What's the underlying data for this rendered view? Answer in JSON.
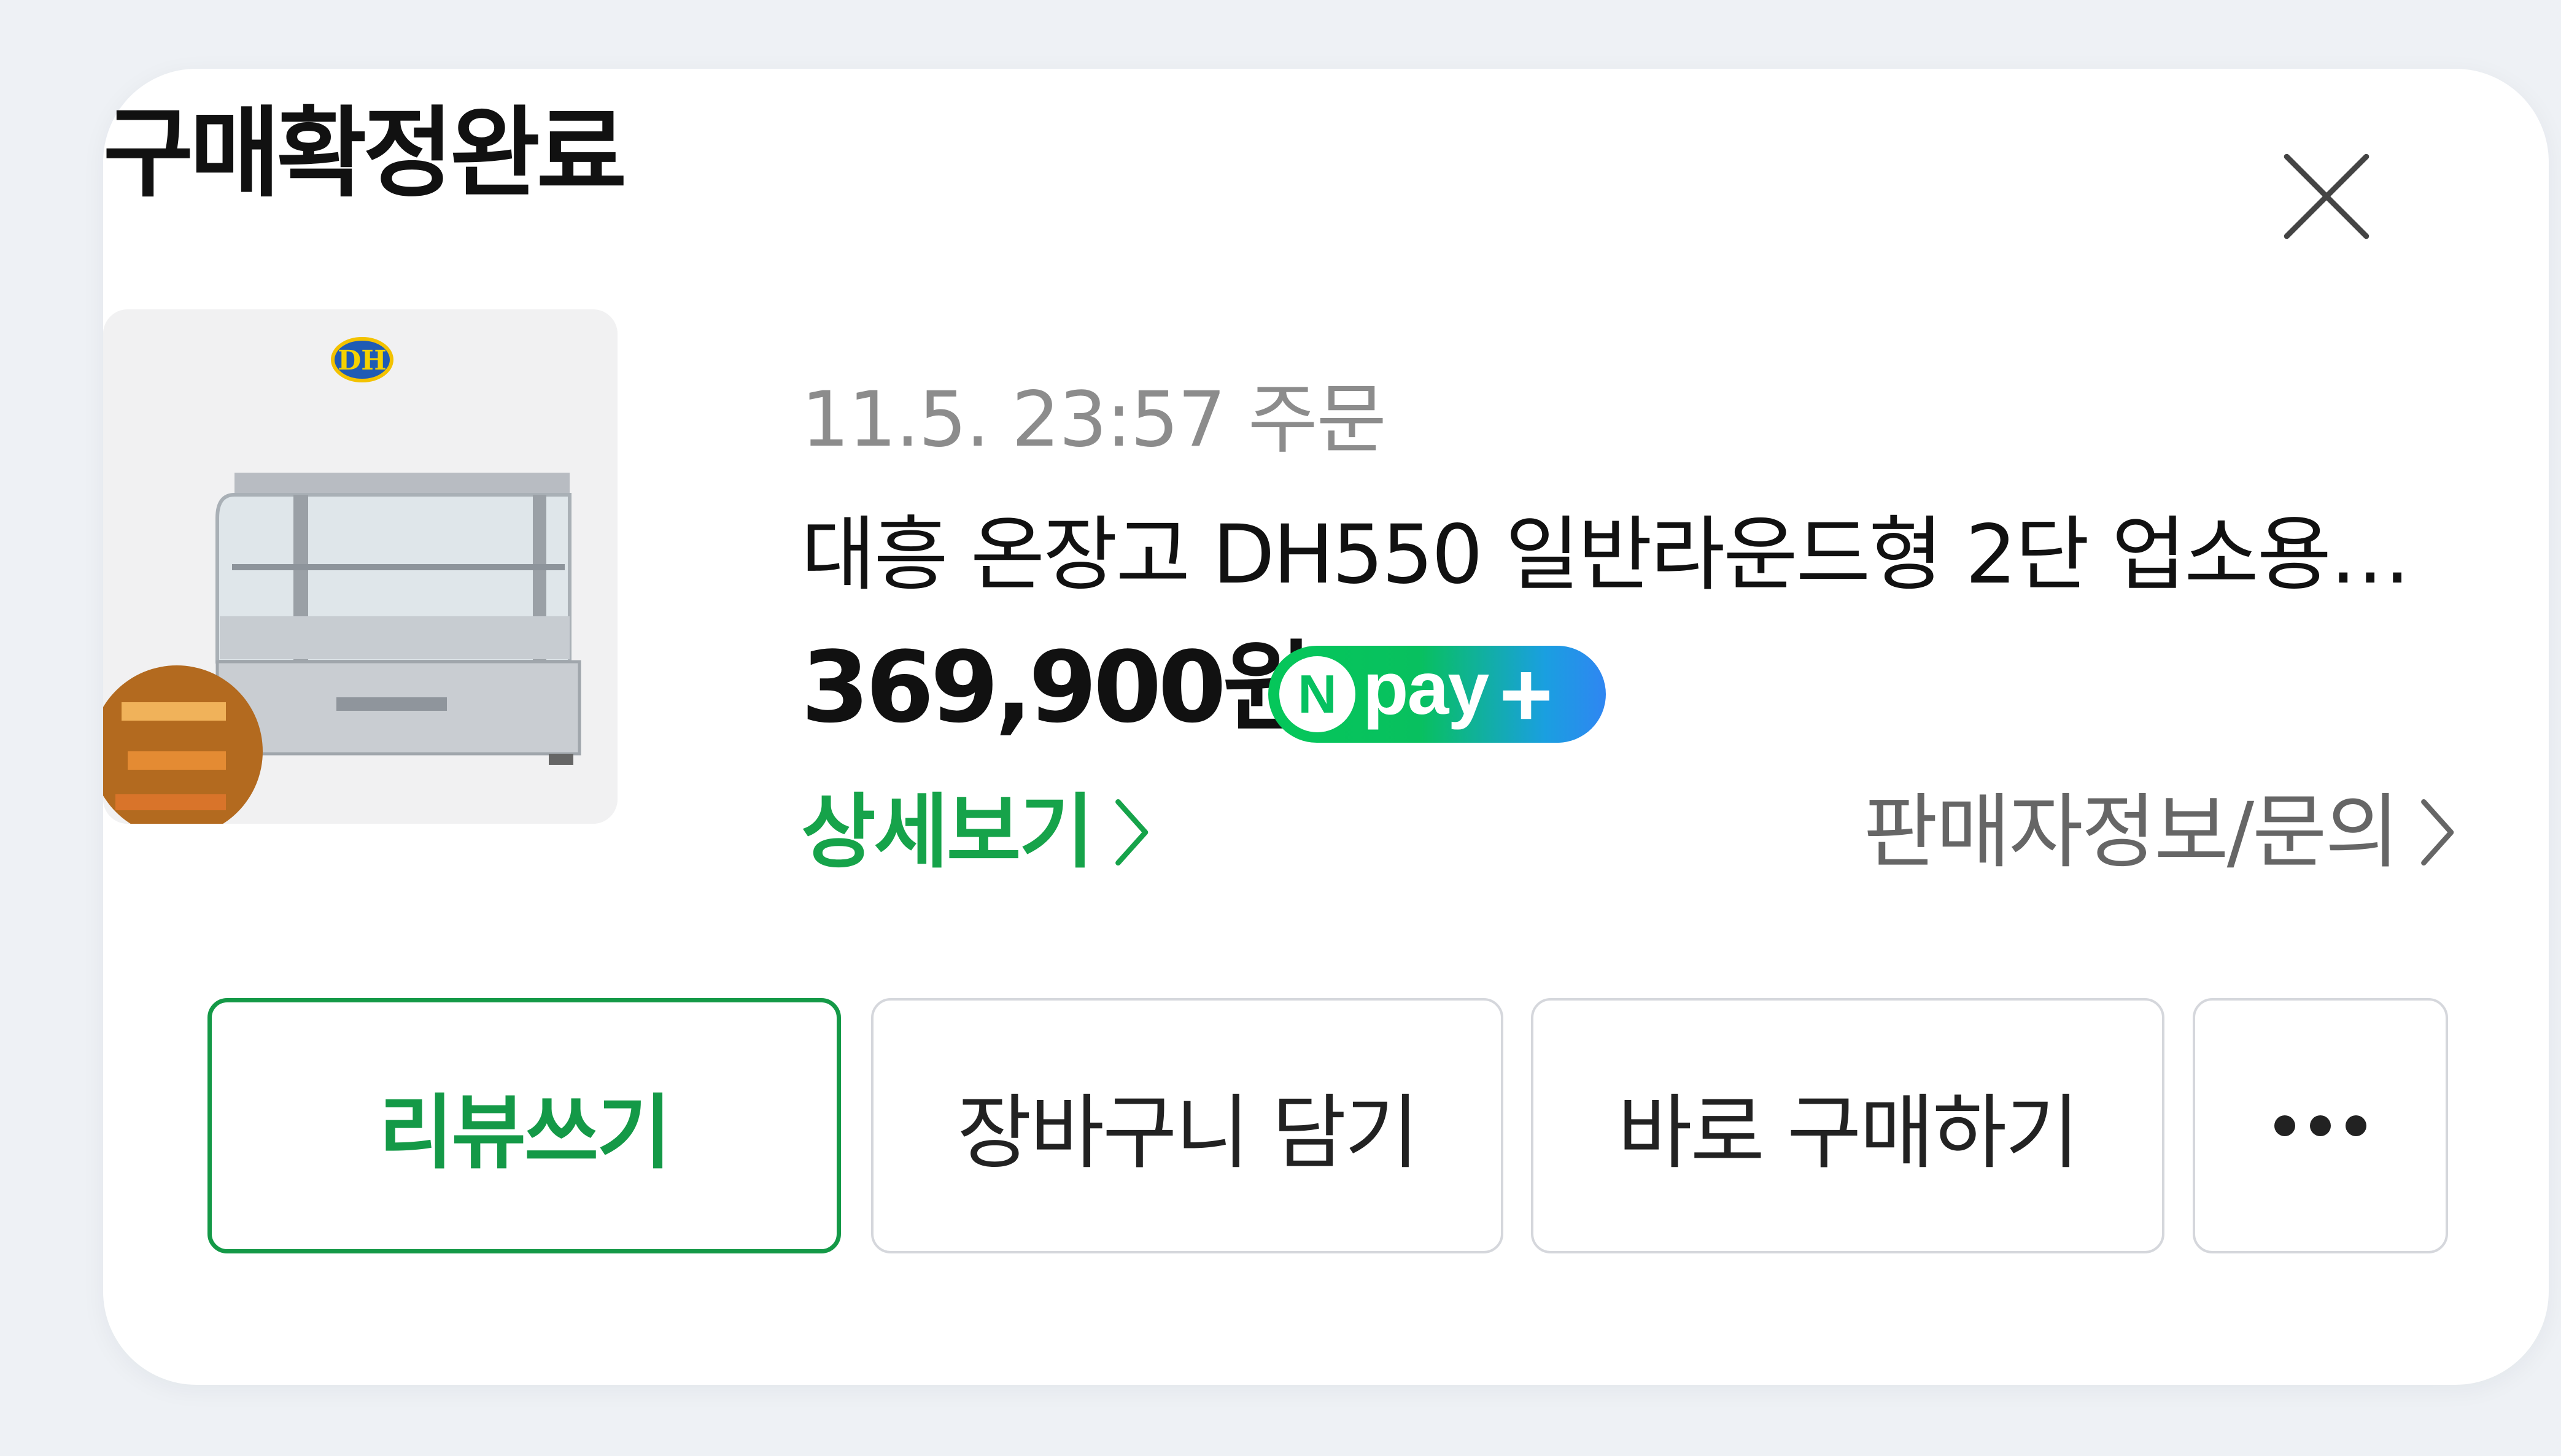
{
  "modal": {
    "title": "구매확정완료",
    "close_icon": "close-icon"
  },
  "order": {
    "time_label": "11.5. 23:57 주문",
    "product_name": "대흥 온장고 DH550 일반라운드형 2단 업소용 ...",
    "price": "369,900원",
    "thumbnail_brand": "DH",
    "npay": {
      "n_letter": "N",
      "text": "pay",
      "plus": "+",
      "colors": [
        "#05c75a",
        "#2f86f2"
      ]
    },
    "detail_link": "상세보기",
    "seller_link": "판매자정보/문의"
  },
  "actions": {
    "review": "리뷰쓰기",
    "cart": "장바구니 담기",
    "buy_now": "바로 구매하기",
    "more_icon": "more-dots-icon"
  },
  "colors": {
    "accent_green": "#149947",
    "text_primary": "#111111",
    "text_muted": "#8c8c8c",
    "border": "#d5d7dc",
    "background": "#eef1f5"
  }
}
